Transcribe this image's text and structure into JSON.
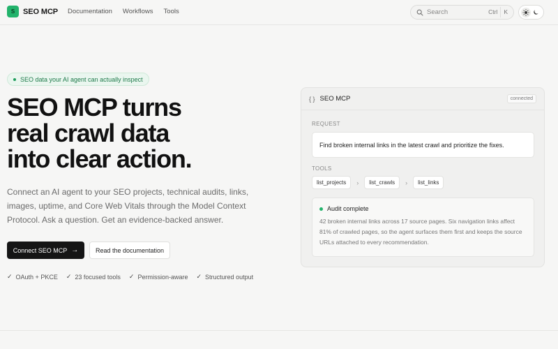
{
  "header": {
    "brand_mark": "S",
    "brand_name": "SEO MCP",
    "nav": [
      "Documentation",
      "Workflows",
      "Tools"
    ],
    "search": {
      "placeholder": "Search",
      "keys": [
        "Ctrl",
        "K"
      ]
    },
    "theme_toggle": {
      "options": [
        "sun-icon",
        "moon-icon"
      ],
      "active": "light"
    }
  },
  "hero": {
    "badge": "SEO data your AI agent can actually inspect",
    "title_lines": [
      "SEO MCP turns",
      "real crawl data",
      "into clear action."
    ],
    "subtitle": "Connect an AI agent to your SEO projects, technical audits, links, images, uptime, and Core Web Vitals through the Model Context Protocol. Ask a question. Get an evidence-backed answer.",
    "primary_cta": "Connect SEO MCP",
    "secondary_cta": "Read the documentation",
    "features": [
      "OAuth + PKCE",
      "23 focused tools",
      "Permission-aware",
      "Structured output"
    ]
  },
  "panel": {
    "glyph": "{ }",
    "title": "SEO MCP",
    "status": "connected",
    "request_label": "REQUEST",
    "request_text": "Find broken internal links in the latest crawl and prioritize the fixes.",
    "tools_label": "TOOLS",
    "tools": [
      "list_projects",
      "list_crawls",
      "list_links"
    ],
    "tool_separator": "›",
    "result_title": "Audit complete",
    "result_body": "42 broken internal links across 17 source pages. Six navigation links affect 81% of crawled pages, so the agent surfaces them first and keeps the source URLs attached to every recommendation."
  },
  "colors": {
    "accent": "#22b36b",
    "background": "#f6f6f5",
    "primary_button": "#151515"
  }
}
